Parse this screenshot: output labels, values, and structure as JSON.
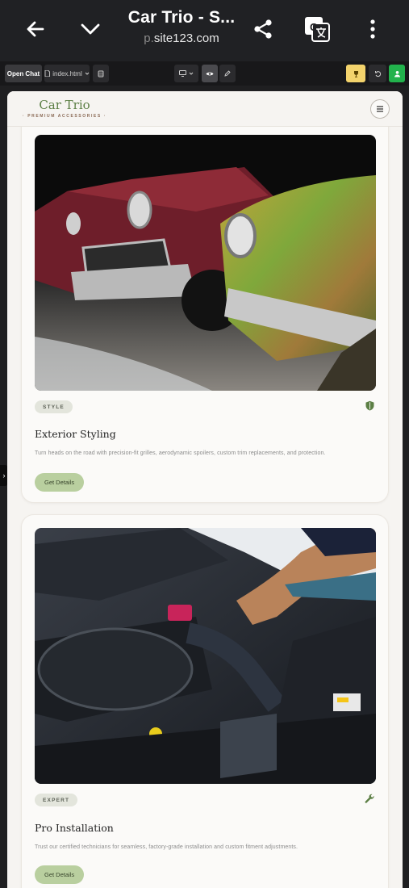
{
  "browser": {
    "title": "Car Trio - S...",
    "url_dim": "p.",
    "url_main": "site123.com"
  },
  "editor": {
    "open_chat": "Open Chat",
    "file": "index.html"
  },
  "site": {
    "logo_name": "Car Trio",
    "logo_tagline": "· PREMIUM ACCESSORIES ·",
    "cards": [
      {
        "tag": "STYLE",
        "icon": "shield-icon",
        "title": "Exterior Styling",
        "description": "Turn heads on the road with precision-fit grilles, aerodynamic spoilers, custom trim replacements, and protection.",
        "cta": "Get Details"
      },
      {
        "tag": "EXPERT",
        "icon": "wrench-icon",
        "title": "Pro Installation",
        "description": "Trust our certified technicians for seamless, factory-grade installation and custom fitment adjustments.",
        "cta": "Get Details"
      }
    ]
  },
  "colors": {
    "accent_green": "#5c7f45",
    "button_green": "#b9cf9f",
    "page_bg": "#f6f4f1"
  }
}
